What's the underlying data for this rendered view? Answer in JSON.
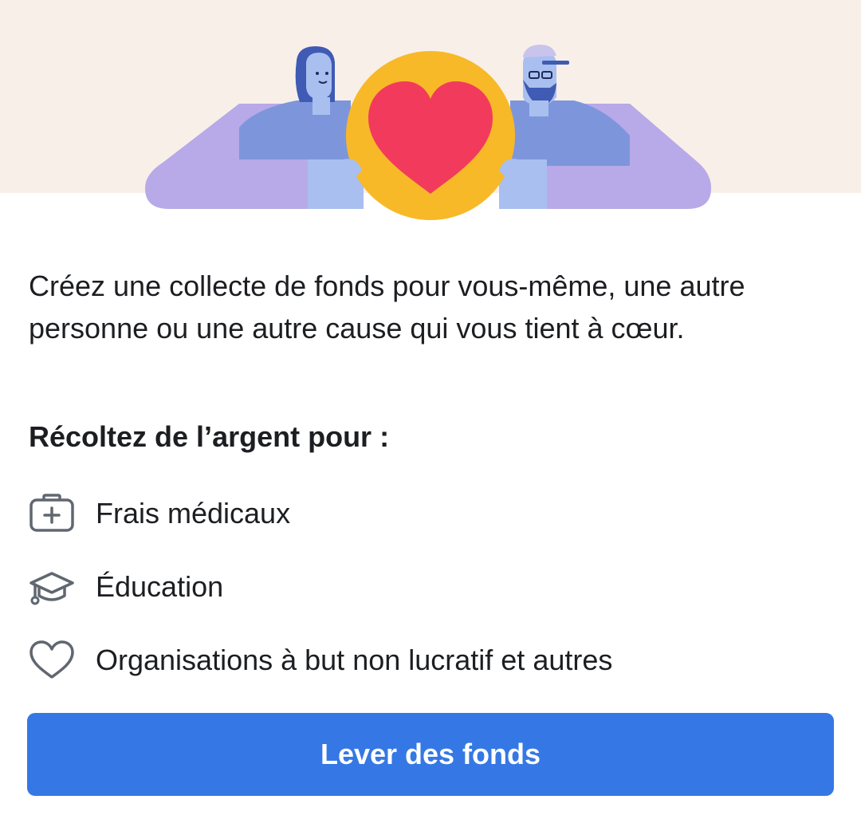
{
  "colors": {
    "hero_background": "#f8efe9",
    "button_background": "#3578e5",
    "button_text": "#ffffff",
    "text_primary": "#1c1e21",
    "icon_stroke": "#606770",
    "heart_red": "#f23b5c",
    "coin_yellow": "#f7b928"
  },
  "hero": {
    "illustration_icon": "two-people-holding-heart-coin"
  },
  "description": "Créez une collecte de fonds pour vous-même, une autre personne ou une autre cause qui vous tient à cœur.",
  "subheading": "Récoltez de l’argent pour :",
  "categories": [
    {
      "icon": "medical-kit-icon",
      "label": "Frais médicaux"
    },
    {
      "icon": "graduation-cap-icon",
      "label": "Éducation"
    },
    {
      "icon": "heart-outline-icon",
      "label": "Organisations à but non lucratif et autres"
    }
  ],
  "cta": {
    "label": "Lever des fonds"
  }
}
